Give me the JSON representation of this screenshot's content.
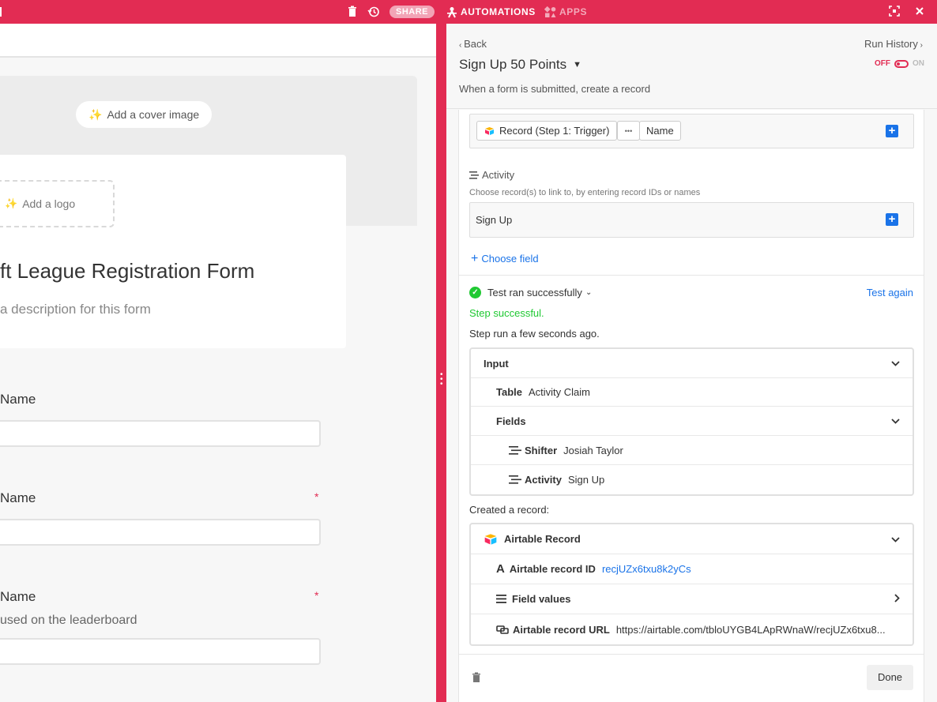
{
  "topbar": {
    "share_label": "SHARE",
    "automations_label": "AUTOMATIONS",
    "apps_label": "APPS",
    "icons": [
      "trash-icon",
      "history-icon",
      "robot-icon",
      "apps-icon",
      "expand-icon",
      "close-icon"
    ]
  },
  "form": {
    "cover_button": "Add a cover image",
    "logo_button": "Add a logo",
    "title": "ft League Registration Form",
    "description": "a description for this form",
    "fields": [
      {
        "label": "Name",
        "required": false,
        "help": ""
      },
      {
        "label": "Name",
        "required": true,
        "help": ""
      },
      {
        "label": " Name",
        "required": true,
        "help": " used on the leaderboard"
      }
    ],
    "required_mark": "*"
  },
  "panel": {
    "back_label": "Back",
    "run_history_label": "Run History",
    "automation_title": "Sign Up 50 Points",
    "toggle_off": "OFF",
    "toggle_on": "ON",
    "trigger_description": "When a form is submitted, create a record",
    "token_record": "Record (Step 1: Trigger)",
    "token_more": "•••",
    "token_field": "Name",
    "activity_label": "Activity",
    "activity_help": "Choose record(s) to link to, by entering record IDs or names",
    "activity_value": "Sign Up",
    "choose_field": "Choose field",
    "test_status": "Test ran successfully",
    "test_again": "Test again",
    "step_success": "Step successful.",
    "step_run": "Step run a few seconds ago.",
    "input": {
      "label": "Input",
      "table_key": "Table",
      "table_value": "Activity Claim",
      "fields_label": "Fields",
      "shifter_key": "Shifter",
      "shifter_value": "Josiah Taylor",
      "activity_key": "Activity",
      "activity_value": "Sign Up"
    },
    "created_label": "Created a record:",
    "output": {
      "label": "Airtable Record",
      "record_id_key": "Airtable record ID",
      "record_id_value": "recjUZx6txu8k2yCs",
      "field_values_key": "Field values",
      "record_url_key": "Airtable record URL",
      "record_url_value": "https://airtable.com/tbloUYGB4LApRWnaW/recjUZx6txu8..."
    },
    "done_label": "Done"
  },
  "colors": {
    "brand": "#e22c53",
    "link": "#1a73e8",
    "success": "#20c933"
  }
}
